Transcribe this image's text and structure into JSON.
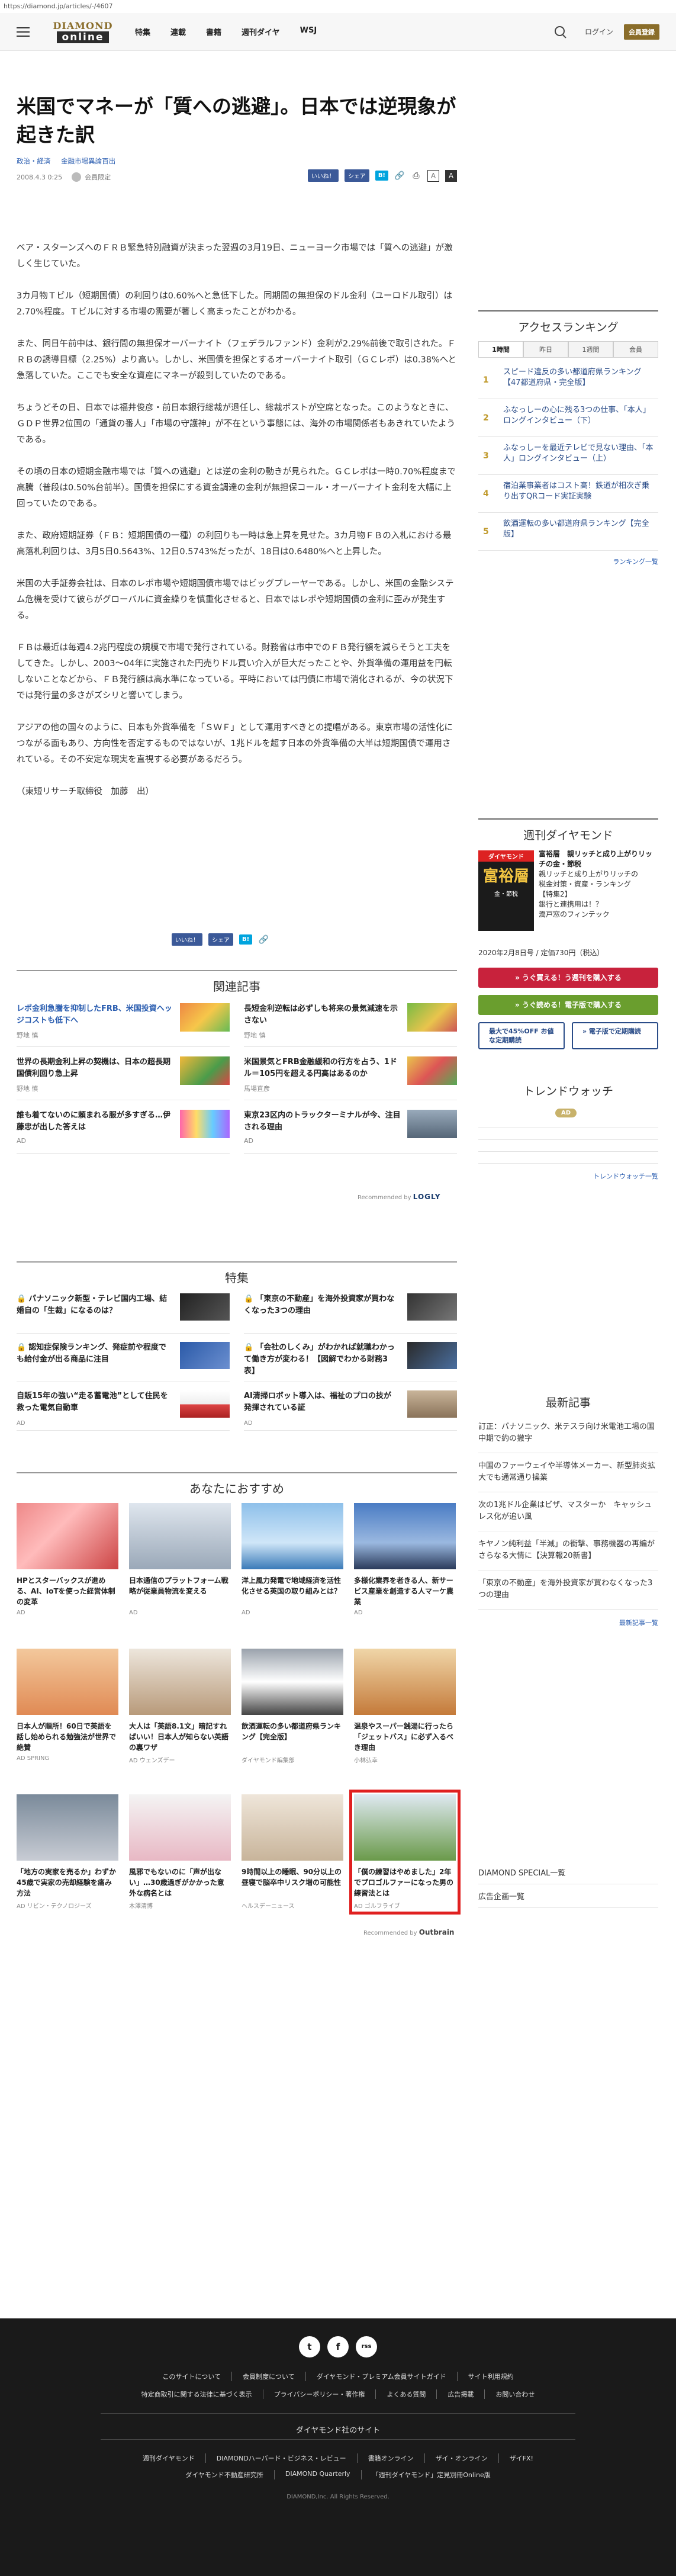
{
  "url": "https://diamond.jp/articles/-/4607",
  "header": {
    "logo_top": "DIAMOND",
    "logo_bottom": "online",
    "nav": [
      "特集",
      "連載",
      "書籍",
      "週刊ダイヤ",
      "WSJ"
    ],
    "login": "ログイン",
    "register": "会員登録"
  },
  "article": {
    "title": "米国でマネーが「質への逃避」。日本では逆現象が起きた訳",
    "tags": [
      "政治・経済",
      "金融市場異論百出"
    ],
    "date": "2008.4.3 0:25",
    "author": "会員限定",
    "paragraphs": [
      "ベア・スターンズへのＦＲＢ緊急特別融資が決まった翌週の3月19日、ニューヨーク市場では「質への逃避」が激しく生じていた。",
      "3カ月物Ｔビル（短期国債）の利回りは0.60%へと急低下した。同期間の無担保のドル金利（ユーロドル取引）は2.70%程度。Ｔビルに対する市場の需要が著しく高まったことがわかる。",
      "また、同日午前中は、銀行間の無担保オーバーナイト（フェデラルファンド）金利が2.29%前後で取引された。ＦＲＢの誘導目標（2.25%）より高い。しかし、米国債を担保とするオーバーナイト取引（ＧＣレポ）は0.38%へと急落していた。ここでも安全な資産にマネーが殺到していたのである。",
      "ちょうどその日、日本では福井俊彦・前日本銀行総裁が退任し、総裁ポストが空席となった。このようなときに、ＧＤＰ世界2位国の「通貨の番人」「市場の守護神」が不在という事態には、海外の市場関係者もあきれていたようである。",
      "その頃の日本の短期金融市場では「質への逃避」とは逆の金利の動きが見られた。ＧＣレポは一時0.70%程度まで高騰（普段は0.50%台前半）。国債を担保にする資金調達の金利が無担保コール・オーバーナイト金利を大幅に上回っていたのである。",
      "また、政府短期証券（ＦＢ：短期国債の一種）の利回りも一時は急上昇を見せた。3カ月物ＦＢの入札における最高落札利回りは、3月5日0.5643%、12日0.5743%だったが、18日は0.6480%へと上昇した。",
      "米国の大手証券会社は、日本のレポ市場や短期国債市場ではビッグプレーヤーである。しかし、米国の金融システム危機を受けて彼らがグローバルに資金繰りを慎重化させると、日本ではレポや短期国債の金利に歪みが発生する。",
      "ＦＢは最近は毎週4.2兆円程度の規模で市場で発行されている。財務省は市中でのＦＢ発行額を減らそうと工夫をしてきた。しかし、2003〜04年に実施された円売りドル買い介入が巨大だったことや、外貨準備の運用益を円転しないことなどから、ＦＢ発行額は高水準になっている。平時においては円債に市場で消化されるが、今の状況下では発行量の多さがズシリと響いてしまう。",
      "アジアの他の国々のように、日本も外貨準備を「ＳＷＦ」として運用すべきとの提唱がある。東京市場の活性化につながる面もあり、方向性を否定するものではないが、1兆ドルを超す日本の外貨準備の大半は短期国債で運用されている。その不安定な現実を直視する必要があるだろう。",
      "（東短リサーチ取締役　加藤　出）"
    ]
  },
  "share": {
    "like": "いいね！",
    "share": "シェア",
    "hatena": "B!"
  },
  "related": {
    "title": "関連記事",
    "items": [
      {
        "text": "レポ金利急騰を抑制したFRB、米国投資ヘッジコストも低下へ",
        "src": "野地 慎"
      },
      {
        "text": "長短金利逆転は必ずしも将来の景気減速を示さない",
        "src": "野地 慎"
      },
      {
        "text": "世界の長期金利上昇の契機は、日本の超長期国債利回り急上昇",
        "src": "野地 慎"
      },
      {
        "text": "米国景気とFRB金融緩和の行方を占う、1ドル＝105円を超える円高はあるのか",
        "src": "馬場直彦"
      },
      {
        "text": "誰も着てないのに頼まれる服が多すぎる…伊藤忠が出した答えは",
        "src": "AD"
      },
      {
        "text": "東京23区内のトラックターミナルが今、注目される理由",
        "src": "AD"
      }
    ],
    "recommended_by": "Recommended by",
    "logly": "LOGLY"
  },
  "featured": {
    "title": "特集",
    "items": [
      {
        "text": "パナソニック新型・テレビ国内工場、結婚自の「生裁」になるのは？",
        "src": ""
      },
      {
        "text": "「東京の不動産」を海外投資家が買わなくなった3つの理由",
        "src": ""
      },
      {
        "text": "認知症保険ランキング、発症前や程度でも給付金が出る商品に注目",
        "src": ""
      },
      {
        "text": "「会社のしくみ」がわかれば就職わかって働き方が変わる！【図解でわかる財務3表】",
        "src": ""
      },
      {
        "text": "自販15年の強い“走る蓄電池”として住民を救った電気自動車",
        "src": "AD"
      },
      {
        "text": "AI清掃ロボット導入は、福祉のプロの技が発揮されている証",
        "src": "AD"
      }
    ]
  },
  "recommend": {
    "title": "あなたにおすすめ",
    "items": [
      {
        "text": "HPとスターバックスが進める、AI、IoTを使った経営体制の変革",
        "src": "AD"
      },
      {
        "text": "日本通信のプラットフォーム戦略が従業員物流を変える",
        "src": "AD"
      },
      {
        "text": "洋上風力発電で地域経済を活性化させる英国の取り組みとは？",
        "src": "AD"
      },
      {
        "text": "多様化業界を者きる人、新サービス産業を創造する人マーケ農業",
        "src": "AD"
      },
      {
        "text": "日本人が順所！60日で英語を話し始められる勉強法が世界で絶賛",
        "src": "AD SPRING"
      },
      {
        "text": "大人は「英語8.1文」暗記すればいい！日本人が知らない英語の裏ワザ",
        "src": "AD ウェンズデー"
      },
      {
        "text": "飲酒運転の多い都道府県ランキング【完全版】",
        "src": "ダイヤモンド編集部"
      },
      {
        "text": "温泉やスーパー銭湯に行ったら「ジェットバス」に必ず入るべき理由",
        "src": "小林弘幸"
      },
      {
        "text": "「地方の実家を売るか」わずか45歳で実家の売却経験を痛み方法",
        "src": "AD リビン・テクノロジーズ"
      },
      {
        "text": "風邪でもないのに「声が出ない」…30歳過ぎがかかった意外な病名とは",
        "src": "木澤清博"
      },
      {
        "text": "9時間以上の睡眠、90分以上の昼寝で脳卒中リスク増の可能性",
        "src": "ヘルスデーニュース"
      },
      {
        "text": "「僕の練習はやめました」2年でプロゴルファーになった男の練習法とは",
        "src": "AD ゴルフライブ"
      }
    ],
    "recommended_by": "Recommended by",
    "outbrain": "Outbrain"
  },
  "sidebar": {
    "ranking_title": "アクセスランキング",
    "tabs": [
      "1時間",
      "昨日",
      "1週間",
      "会員"
    ],
    "ranking": [
      {
        "num": "1",
        "text": "スピード違反の多い都道府県ランキング【47都道府県・完全版】"
      },
      {
        "num": "2",
        "text": "ふなっしーの心に残る3つの仕事、「本人」ロングインタビュー（下）"
      },
      {
        "num": "3",
        "text": "ふなっしーを最近テレビで見ない理由、「本人」ロングインタビュー（上）"
      },
      {
        "num": "4",
        "text": "宿泊業事業者はコスト高！鉄道が相次ぎ乗り出すQRコード実証実験"
      },
      {
        "num": "5",
        "text": "飲酒運転の多い都道府県ランキング【完全版】"
      }
    ],
    "ranking_more": "ランキング一覧",
    "magazine_title": "週刊ダイヤモンド",
    "cover_top": "ダイヤモンド",
    "cover_main": "富裕層",
    "cover_sub": "金・節税",
    "mag_headline": "富裕層　親リッチと成り上がりリッチの金・節税",
    "mag_lines": [
      "親リッチと成り上がりリッチの",
      "税金対策・資産・ランキング",
      "【特集2】",
      "銀行と連携用は！？",
      "潤戸窓のフィンテック"
    ],
    "mag_price": "2020年2月8日号 / 定価730円（税込）",
    "btn_buy": "» うぐ買える！う週刊を購入する",
    "btn_read": "» うぐ読める！電子版で購入する",
    "btn_sub1": "最大で45%OFF お値な定期購読",
    "btn_sub2": "» 電子版で定期購読",
    "trend_title": "トレンドウォッチ",
    "ad": "AD",
    "trend_more": "トレンドウォッチ一覧",
    "news_title": "最新記事",
    "news": [
      "訂正：パナソニック、米テスラ向け米電池工場の国中期で約の撤字",
      "中国のファーウェイや半導体メーカー、新型肺炎拡大でも通常通り操業",
      "次の1兆ドル企業はビザ、マスターか　キャッシュレス化が追い風",
      "キヤノン純利益「半減」の衝撃、事務機器の再編がさらなる大情に【決算報20新書】",
      "「東京の不動産」を海外投資家が買わなくなった3つの理由"
    ],
    "news_more": "最新記事一覧",
    "special": "DIAMOND SPECIAL一覧",
    "ad_page": "広告企画一覧"
  },
  "footer": {
    "social": [
      "t",
      "f",
      "rss"
    ],
    "row1": [
      "このサイトについて",
      "会員制度について",
      "ダイヤモンド・プレミアム会員サイトガイド",
      "サイト利用規約"
    ],
    "row2": [
      "特定商取引に関する法律に基づく表示",
      "プライバシーポリシー・著作権",
      "よくある質問",
      "広告掲載",
      "お問い合わせ"
    ],
    "group_title": "ダイヤモンド社のサイト",
    "row3": [
      "週刊ダイヤモンド",
      "DIAMONDハーバード・ビジネス・レビュー",
      "書籍オンライン",
      "ザイ・オンライン",
      "ザイFX!"
    ],
    "row4": [
      "ダイヤモンド不動産研究所",
      "DIAMOND Quarterly",
      "「週刊ダイヤモンド」定見別冊Online版"
    ],
    "copyright": "DIAMOND,Inc. All Rights Reserved."
  },
  "colors": {
    "gold": "#8a6d2a",
    "link": "#2a5db0",
    "buy_red": "#c8223c",
    "read_green": "#6a9e2e",
    "highlight": "#e02020"
  }
}
